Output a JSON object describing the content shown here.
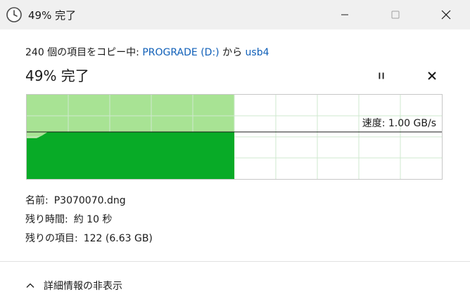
{
  "window": {
    "title": "49% 完了",
    "icons": {
      "app": "clock-icon",
      "minimize": "minimize-icon",
      "maximize": "maximize-icon",
      "close": "close-icon"
    }
  },
  "copy": {
    "count_text": "240 個の項目をコピー中: ",
    "source": "PROGRADE (D:)",
    "middle": " から ",
    "destination": "usb4"
  },
  "progress": {
    "heading": "49% 完了",
    "percent": 49,
    "pause_icon": "pause-icon",
    "cancel_icon": "cancel-icon"
  },
  "speed": {
    "label": "速度: 1.00 GB/s"
  },
  "details": {
    "name_label": "名前:",
    "name_value": "P3070070.dng",
    "time_label": "残り時間:",
    "time_value": "約 10 秒",
    "items_label": "残りの項目:",
    "items_value": "122 (6.63 GB)"
  },
  "toggle": {
    "label": "詳細情報の非表示",
    "icon": "chevron-up-icon"
  },
  "colors": {
    "progress_fill": "#a8e394",
    "speed_fill": "#08ab27",
    "grid": "#cfe8cf",
    "link": "#0f5fb8"
  }
}
